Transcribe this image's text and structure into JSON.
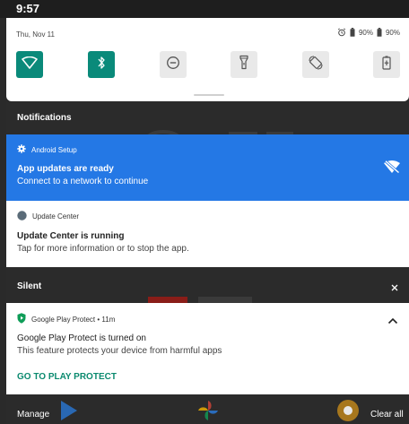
{
  "status_bar": {
    "time": "9:57"
  },
  "quick_settings": {
    "date": "Thu, Nov 11",
    "battery_1": "90%",
    "battery_2": "90%",
    "tiles": [
      {
        "name": "wifi",
        "state": "on"
      },
      {
        "name": "bluetooth",
        "state": "on"
      },
      {
        "name": "do-not-disturb",
        "state": "off"
      },
      {
        "name": "flashlight",
        "state": "off"
      },
      {
        "name": "auto-rotate",
        "state": "off"
      },
      {
        "name": "battery-saver",
        "state": "off"
      }
    ]
  },
  "sections": {
    "notifications": "Notifications",
    "silent": "Silent"
  },
  "notifications": [
    {
      "app": "Android Setup",
      "title": "App updates are ready",
      "text": "Connect to a network to continue"
    },
    {
      "app": "Update Center",
      "title": "Update Center is running",
      "text": "Tap for more information or to stop the app."
    },
    {
      "app": "Google Play Protect • 11m",
      "title": "Google Play Protect is turned on",
      "text": "This feature protects your device from harmful apps",
      "action": "GO TO PLAY PROTECT"
    }
  ],
  "footer": {
    "manage": "Manage",
    "clear_all": "Clear all"
  },
  "colors": {
    "accent_teal": "#0a8a7a",
    "setup_blue": "#2478e5",
    "play_green": "#0f9d58"
  }
}
